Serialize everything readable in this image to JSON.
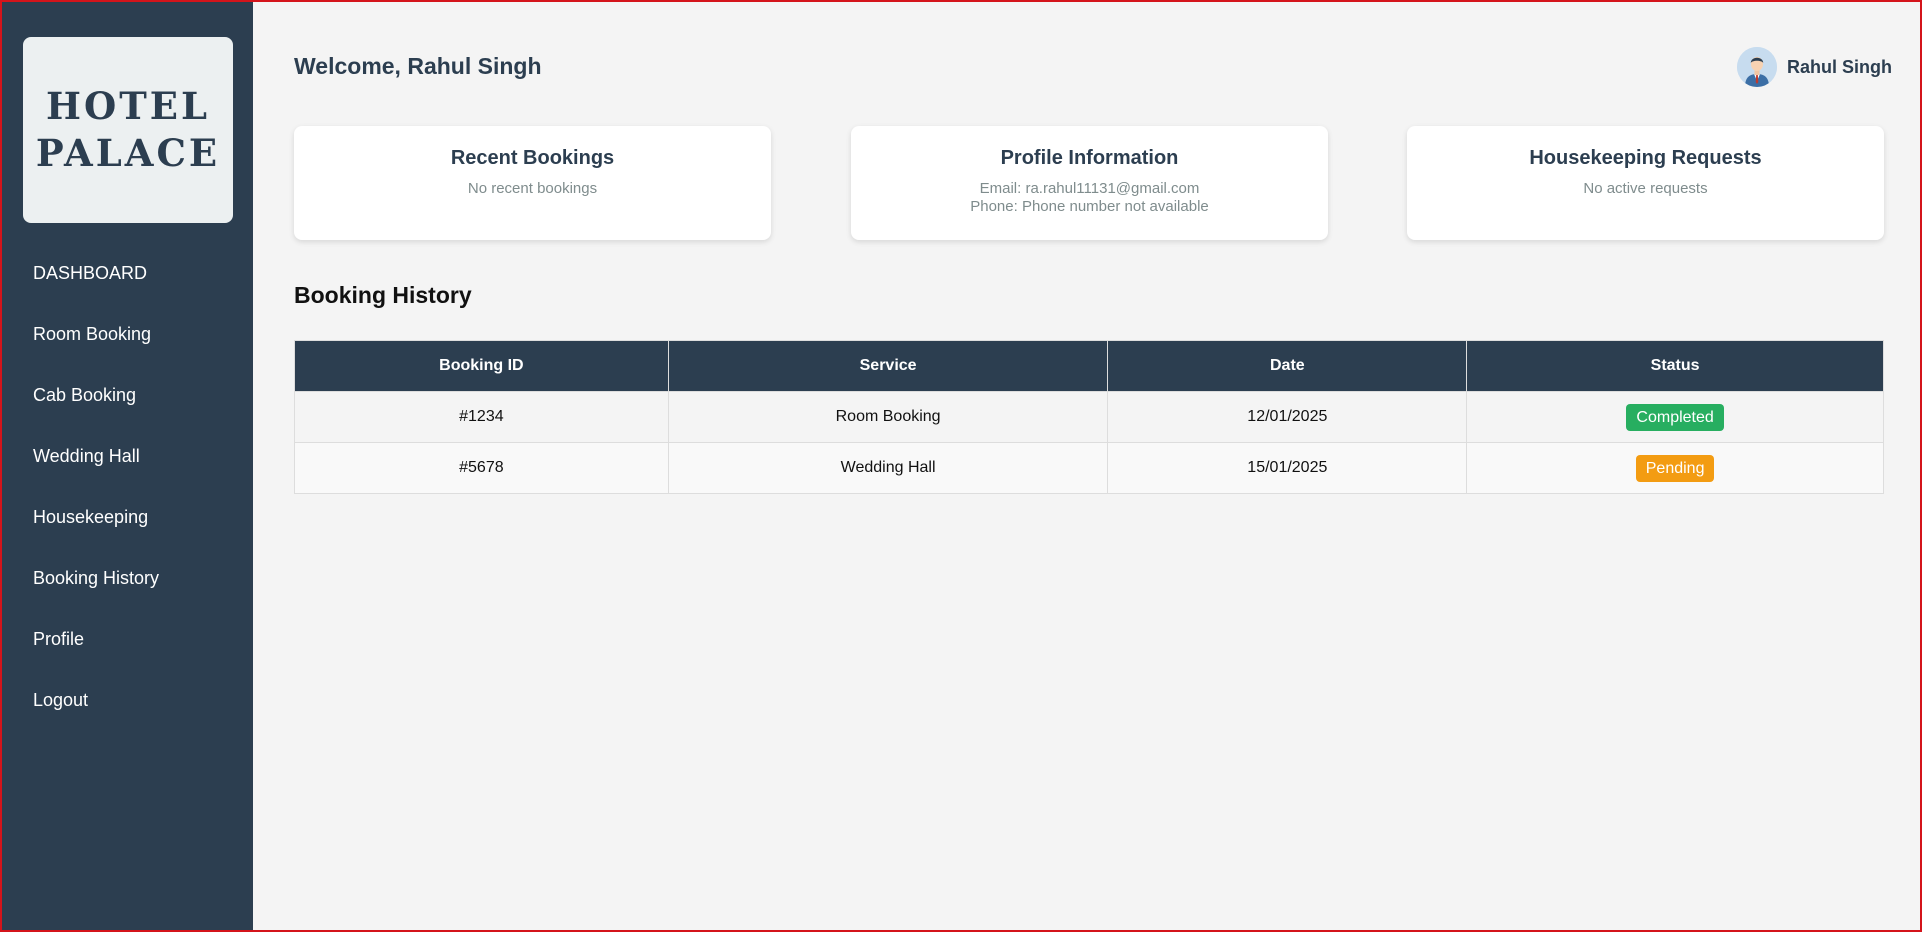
{
  "sidebar": {
    "logo": "HOTEL\nPALACE",
    "items": [
      {
        "label": "DASHBOARD"
      },
      {
        "label": "Room Booking"
      },
      {
        "label": "Cab Booking"
      },
      {
        "label": "Wedding Hall"
      },
      {
        "label": "Housekeeping"
      },
      {
        "label": "Booking History"
      },
      {
        "label": "Profile"
      },
      {
        "label": "Logout"
      }
    ]
  },
  "header": {
    "welcome": "Welcome, Rahul Singh",
    "user_name": "Rahul Singh",
    "avatar_icon": "user-avatar-icon"
  },
  "cards": [
    {
      "title": "Recent Bookings",
      "lines": [
        "No recent bookings"
      ]
    },
    {
      "title": "Profile Information",
      "lines": [
        "Email: ra.rahul11131@gmail.com",
        "Phone: Phone number not available"
      ]
    },
    {
      "title": "Housekeeping Requests",
      "lines": [
        "No active requests"
      ]
    }
  ],
  "history": {
    "title": "Booking History",
    "columns": [
      "Booking ID",
      "Service",
      "Date",
      "Status"
    ],
    "rows": [
      {
        "id": "#1234",
        "service": "Room Booking",
        "date": "12/01/2025",
        "status": "Completed"
      },
      {
        "id": "#5678",
        "service": "Wedding Hall",
        "date": "15/01/2025",
        "status": "Pending"
      }
    ]
  },
  "colors": {
    "sidebar_bg": "#2c3e50",
    "completed": "#27ae60",
    "pending": "#f39c12"
  }
}
